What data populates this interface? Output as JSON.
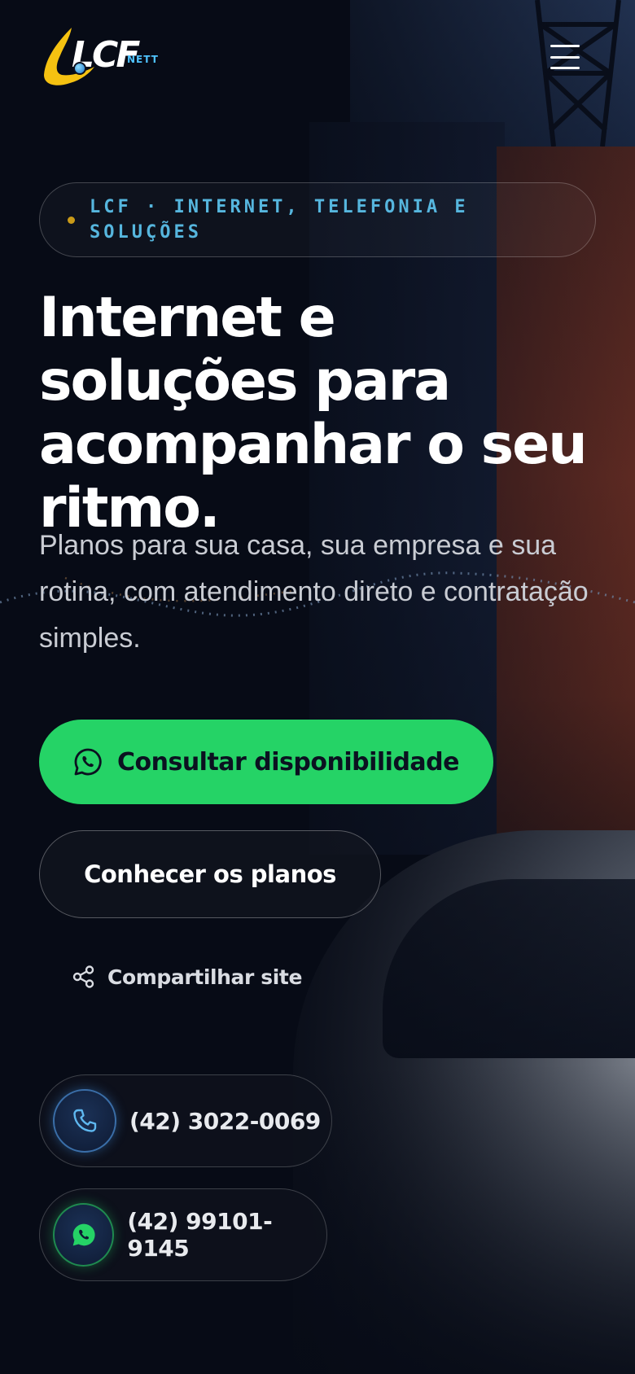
{
  "brand": {
    "logo_mark": "LCF",
    "logo_suffix": "NETT",
    "accent_color": "#25d366",
    "badge_color": "#56b6de"
  },
  "header": {
    "menu_icon": "hamburger-menu-icon"
  },
  "hero": {
    "badge": "LCF · INTERNET, TELEFONIA E SOLUÇÕES",
    "headline": "Internet e soluções para acompanhar o seu ritmo.",
    "subtitle": "Planos para sua casa, sua empresa e sua rotina, com atendimento direto e contratação simples."
  },
  "actions": {
    "primary_label": "Consultar disponibilidade",
    "primary_icon": "whatsapp-icon",
    "secondary_label": "Conhecer os planos",
    "share_label": "Compartilhar site",
    "share_icon": "share-icon"
  },
  "contacts": [
    {
      "type": "phone",
      "icon": "phone-icon",
      "number": "(42) 3022-0069"
    },
    {
      "type": "whatsapp",
      "icon": "whatsapp-icon",
      "number": "(42) 99101-9145"
    }
  ]
}
